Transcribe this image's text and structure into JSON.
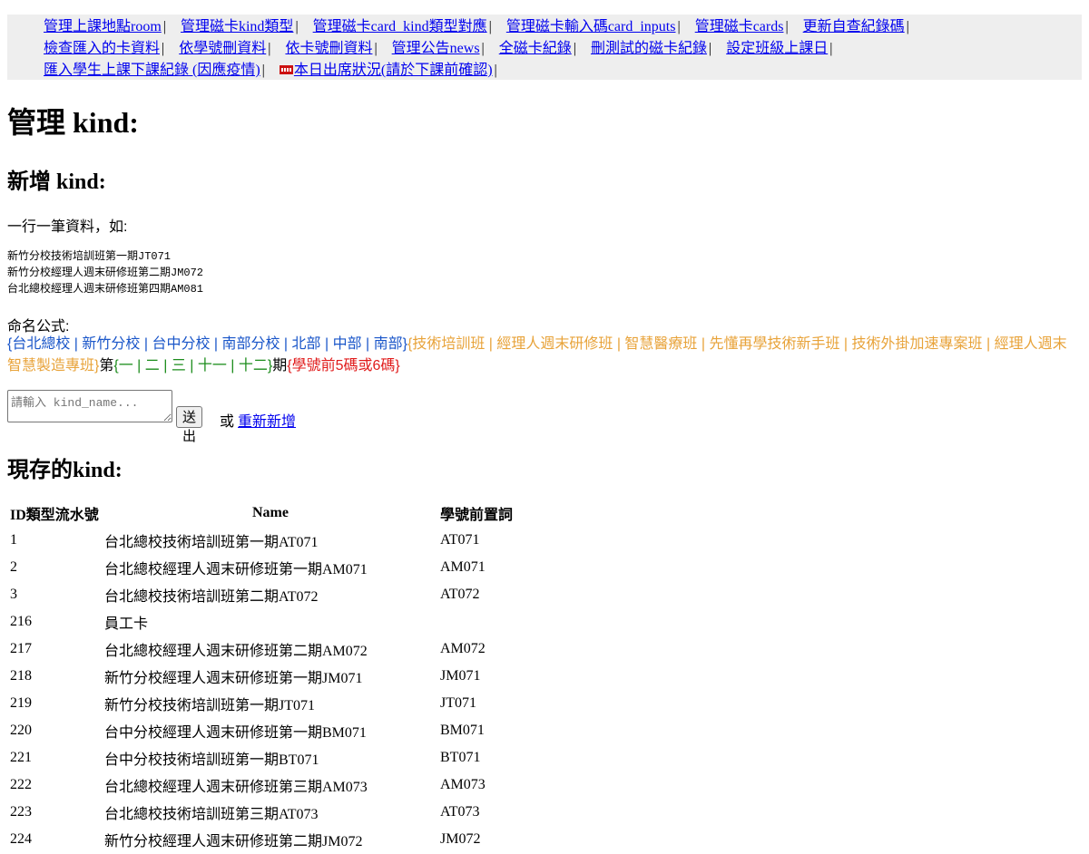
{
  "nav": {
    "links": [
      "管理上課地點room",
      "管理磁卡kind類型",
      "管理磁卡card_kind類型對應",
      "管理磁卡輸入碼card_inputs",
      "管理磁卡cards",
      "更新自查紀錄碼",
      "檢查匯入的卡資料",
      "依學號刪資料",
      "依卡號刪資料",
      "管理公告news",
      "全磁卡紀錄",
      "刪測試的磁卡紀錄",
      "設定班級上課日",
      "匯入學生上課下課紀錄 (因應疫情)",
      "本日出席狀況(請於下課前確認)"
    ],
    "separator": "|"
  },
  "page_title": "管理 kind:",
  "add_section": {
    "title": "新增 kind:",
    "intro": "一行一筆資料，如:",
    "examples": [
      "新竹分校技術培訓班第一期JT071",
      "新竹分校經理人週末研修班第二期JM072",
      "台北總校經理人週末研修班第四期AM081"
    ],
    "formula_label": "命名公式:",
    "formula": {
      "part_locations": "{台北總校 | 新竹分校 | 台中分校 | 南部分校 | 北部 | 中部 | 南部}",
      "part_classes": "{技術培訓班 | 經理人週末研修班 | 智慧醫療班 | 先懂再學技術新手班 | 技術外掛加速專案班 | 經理人週末智慧製造專班}",
      "part_di": "第",
      "part_terms": "{一 | 二 | 三 | 十一 | 十二}",
      "part_qi": "期",
      "part_prefix": "{學號前5碼或6碼}"
    },
    "input_placeholder": "請輸入 kind_name...",
    "submit_label": "送出",
    "or_text": "或",
    "reset_link": "重新新增"
  },
  "existing_section": {
    "title": "現存的kind:",
    "columns": [
      "ID類型流水號",
      "Name",
      "學號前置詞"
    ],
    "rows": [
      [
        "1",
        "台北總校技術培訓班第一期AT071",
        "AT071"
      ],
      [
        "2",
        "台北總校經理人週末研修班第一期AM071",
        "AM071"
      ],
      [
        "3",
        "台北總校技術培訓班第二期AT072",
        "AT072"
      ],
      [
        "216",
        "員工卡",
        ""
      ],
      [
        "217",
        "台北總校經理人週末研修班第二期AM072",
        "AM072"
      ],
      [
        "218",
        "新竹分校經理人週末研修班第一期JM071",
        "JM071"
      ],
      [
        "219",
        "新竹分校技術培訓班第一期JT071",
        "JT071"
      ],
      [
        "220",
        "台中分校經理人週末研修班第一期BM071",
        "BM071"
      ],
      [
        "221",
        "台中分校技術培訓班第一期BT071",
        "BT071"
      ],
      [
        "222",
        "台北總校經理人週末研修班第三期AM073",
        "AM073"
      ],
      [
        "223",
        "台北總校技術培訓班第三期AT073",
        "AT073"
      ],
      [
        "224",
        "新竹分校經理人週末研修班第二期JM072",
        "JM072"
      ]
    ]
  },
  "colors": {
    "link": "#0000ee",
    "nav_background": "#eeeeee",
    "formula_locations": "#1a56c9",
    "formula_classes": "#e8a33a",
    "formula_terms": "#1c8c1c",
    "formula_prefix": "#e01b1b"
  }
}
